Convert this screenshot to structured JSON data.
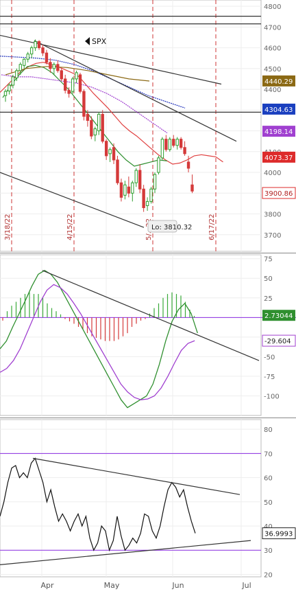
{
  "symbol": "SPX",
  "colors": {
    "up": "#2e9e2e",
    "down": "#d43a3a",
    "ma_red": "#e04040",
    "ma_green": "#2f8f2f",
    "ma_blue": "#2233bb",
    "ma_purple": "#a040d0",
    "ma_brown": "#8b6914",
    "macd_line": "#2f8f2f",
    "signal_line": "#a040d0",
    "rsi_line": "#111111",
    "level_purple": "#8a2be2",
    "event_line": "#cc3333",
    "badge_purple": "#a040d0",
    "badge_blue": "#1a3fbf",
    "badge_brown": "#8b6914",
    "badge_red": "#dd2b2b"
  },
  "chart_data": [
    {
      "type": "candlestick",
      "title": "SPX",
      "ylim": [
        3620,
        4830
      ],
      "yticks": [
        3700,
        3800,
        3900,
        4000,
        4100,
        4200,
        4300,
        4400,
        4500,
        4600,
        4700,
        4800
      ],
      "x_labels": [
        "Apr",
        "May",
        "Jun",
        "Jul"
      ],
      "event_dates": [
        "3/18/22",
        "4/15/22",
        "5/...22",
        "6/17/22"
      ],
      "low_annotation": "Lo: 3810.32",
      "badges": [
        {
          "value": "4440.29",
          "color": "brown"
        },
        {
          "value": "4304.63",
          "color": "blue"
        },
        {
          "value": "4198.14",
          "color": "purple"
        },
        {
          "value": "4073.37",
          "color": "red"
        },
        {
          "value": "3900.86",
          "color": "red_outline"
        }
      ],
      "horizontal_levels": [
        4752,
        4715,
        4290
      ],
      "candles": [
        [
          4370,
          4400,
          4340,
          4390
        ],
        [
          4392,
          4430,
          4375,
          4420
        ],
        [
          4420,
          4470,
          4405,
          4460
        ],
        [
          4455,
          4500,
          4440,
          4490
        ],
        [
          4490,
          4530,
          4470,
          4520
        ],
        [
          4515,
          4550,
          4500,
          4545
        ],
        [
          4545,
          4580,
          4530,
          4570
        ],
        [
          4570,
          4610,
          4550,
          4600
        ],
        [
          4600,
          4640,
          4585,
          4630
        ],
        [
          4630,
          4637,
          4590,
          4600
        ],
        [
          4600,
          4615,
          4560,
          4575
        ],
        [
          4575,
          4590,
          4520,
          4530
        ],
        [
          4530,
          4550,
          4480,
          4500
        ],
        [
          4500,
          4530,
          4470,
          4520
        ],
        [
          4520,
          4540,
          4480,
          4490
        ],
        [
          4490,
          4500,
          4440,
          4450
        ],
        [
          4450,
          4470,
          4380,
          4395
        ],
        [
          4395,
          4410,
          4360,
          4380
        ],
        [
          4390,
          4460,
          4380,
          4450
        ],
        [
          4450,
          4490,
          4430,
          4480
        ],
        [
          4470,
          4480,
          4380,
          4390
        ],
        [
          4390,
          4400,
          4250,
          4270
        ],
        [
          4280,
          4300,
          4220,
          4250
        ],
        [
          4250,
          4270,
          4160,
          4175
        ],
        [
          4180,
          4220,
          4150,
          4210
        ],
        [
          4200,
          4290,
          4180,
          4280
        ],
        [
          4280,
          4300,
          4140,
          4150
        ],
        [
          4150,
          4160,
          4060,
          4080
        ],
        [
          4090,
          4120,
          4050,
          4110
        ],
        [
          4120,
          4140,
          4040,
          4060
        ],
        [
          4060,
          4080,
          3940,
          3950
        ],
        [
          3950,
          3970,
          3860,
          3880
        ],
        [
          3890,
          3960,
          3870,
          3940
        ],
        [
          3930,
          3980,
          3880,
          3900
        ],
        [
          3900,
          3960,
          3860,
          3950
        ],
        [
          3950,
          4020,
          3930,
          4010
        ],
        [
          4010,
          4040,
          3900,
          3920
        ],
        [
          3920,
          3940,
          3810,
          3830
        ],
        [
          3840,
          3880,
          3815,
          3860
        ],
        [
          3860,
          3930,
          3850,
          3920
        ],
        [
          3920,
          4000,
          3900,
          3990
        ],
        [
          4000,
          4080,
          3990,
          4070
        ],
        [
          4070,
          4170,
          4060,
          4160
        ],
        [
          4160,
          4180,
          4100,
          4110
        ],
        [
          4110,
          4170,
          4100,
          4160
        ],
        [
          4160,
          4180,
          4120,
          4130
        ],
        [
          4130,
          4170,
          4110,
          4160
        ],
        [
          4160,
          4170,
          4110,
          4120
        ],
        [
          4120,
          4150,
          4080,
          4090
        ],
        [
          4050,
          4080,
          4000,
          4020
        ],
        [
          3940,
          3990,
          3900,
          3910
        ]
      ],
      "moving_averages": [
        {
          "name": "MA red",
          "color": "ma_red",
          "values": [
            4385,
            4420,
            4455,
            4490,
            4510,
            4525,
            4530,
            4520,
            4510,
            4495,
            4480,
            4460,
            4420,
            4380,
            4345,
            4310,
            4270,
            4230,
            4200,
            4175,
            4145,
            4115,
            4085,
            4060,
            4040,
            4045,
            4060,
            4080,
            4085,
            4080,
            4075,
            4050
          ]
        },
        {
          "name": "MA green",
          "color": "ma_green",
          "values": [
            4360,
            4420,
            4470,
            4510,
            4515,
            4505,
            4480,
            4440,
            4400,
            4350,
            4300,
            4250,
            4200,
            4150,
            4100,
            4060,
            4030,
            4040,
            4050,
            4060,
            4055
          ]
        },
        {
          "name": "MA blue",
          "color": "ma_blue",
          "values": [
            4560,
            4555,
            4550,
            4540,
            4520,
            4490,
            4450,
            4410,
            4370,
            4340,
            4310
          ]
        },
        {
          "name": "MA purple",
          "color": "ma_purple",
          "values": [
            4470,
            4460,
            4460,
            4450,
            4440,
            4430,
            4410,
            4380,
            4340,
            4290,
            4240,
            4190
          ]
        },
        {
          "name": "MA brown",
          "color": "ma_brown",
          "values": [
            4470,
            4500,
            4510,
            4505,
            4490,
            4470,
            4450,
            4440
          ]
        }
      ]
    },
    {
      "type": "macd",
      "ylim": [
        -125,
        80
      ],
      "yticks": [
        75,
        50,
        25,
        0,
        -25,
        -50,
        -75,
        -100
      ],
      "badges": [
        {
          "value": "2.73044",
          "color": "green"
        },
        {
          "value": "-29.604",
          "color": "purple_outline"
        }
      ],
      "macd": [
        -40,
        -30,
        -12,
        5,
        22,
        40,
        55,
        60,
        55,
        45,
        30,
        15,
        0,
        -15,
        -30,
        -45,
        -60,
        -75,
        -90,
        -105,
        -115,
        -110,
        -105,
        -100,
        -85,
        -60,
        -30,
        -5,
        10,
        18,
        5,
        -20
      ],
      "signal": [
        -70,
        -65,
        -55,
        -40,
        -20,
        0,
        20,
        35,
        42,
        38,
        30,
        18,
        5,
        -10,
        -25,
        -40,
        -55,
        -70,
        -85,
        -95,
        -102,
        -105,
        -104,
        -100,
        -90,
        -75,
        -58,
        -42,
        -33,
        -29.6
      ],
      "histogram": [
        -4,
        8,
        15,
        20,
        25,
        30,
        32,
        30,
        30,
        25,
        18,
        12,
        8,
        4,
        -2,
        -5,
        -8,
        -12,
        -15,
        -20,
        -24,
        -26,
        -28,
        -30,
        -30,
        -30,
        -28,
        -24,
        -20,
        -12,
        -8,
        -4,
        -2,
        5,
        12,
        18,
        25,
        30,
        32,
        30,
        28,
        20,
        10,
        2
      ]
    },
    {
      "type": "line",
      "name": "RSI",
      "ylim": [
        19,
        84
      ],
      "yticks": [
        80,
        70,
        60,
        50,
        40,
        30,
        20
      ],
      "levels": [
        70,
        30
      ],
      "badge": "36.9993",
      "values": [
        44,
        50,
        58,
        64,
        65,
        60,
        62,
        60,
        66,
        68,
        63,
        58,
        50,
        55,
        48,
        42,
        45,
        42,
        38,
        42,
        45,
        40,
        44,
        35,
        30,
        33,
        40,
        38,
        30,
        34,
        44,
        36,
        30,
        32,
        35,
        33,
        37,
        45,
        44,
        38,
        35,
        40,
        48,
        55,
        58,
        56,
        52,
        55,
        48,
        42,
        37
      ]
    }
  ]
}
